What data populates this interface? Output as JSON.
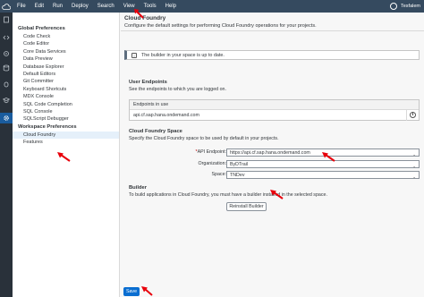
{
  "menubar": {
    "items": [
      "File",
      "Edit",
      "Run",
      "Deploy",
      "Search",
      "View",
      "Tools",
      "Help"
    ],
    "user": "Tesfalem"
  },
  "tree": {
    "global_group": "Global Preferences",
    "global_items": [
      "Code Check",
      "Code Editor",
      "Core Data Services",
      "Data Preview",
      "Database Explorer",
      "Default Editors",
      "Git Committer",
      "Keyboard Shortcuts",
      "MDX Console",
      "SQL Code Completion",
      "SQL Console",
      "SQLScript Debugger"
    ],
    "workspace_group": "Workspace Preferences",
    "workspace_items": [
      "Cloud Foundry",
      "Features"
    ]
  },
  "main": {
    "title": "Cloud Foundry",
    "subtitle": "Configure the default settings for performing Cloud Foundry operations for your projects.",
    "info": "The builder in your space is up to date.",
    "endpoints_title": "User Endpoints",
    "endpoints_desc": "See the endpoints to which you are logged on.",
    "endpoints_col": "Endpoints in use",
    "endpoint_value": "api.cf.sap.hana.ondemand.com",
    "space_title": "Cloud Foundry Space",
    "space_desc": "Specify the Cloud Foundry space to be used by default in your projects.",
    "api_label": "API Endpoint:",
    "api_req": "*",
    "api_value": "https://api.cf.sap.hana.ondemand.com",
    "org_label": "Organization:",
    "org_value": "ByDTrail",
    "space_label": "Space:",
    "space_value": "TNDev",
    "builder_title": "Builder",
    "builder_desc": "To build applications in Cloud Foundry, you must have a builder installed in the selected space.",
    "reinstall_label": "Reinstall Builder",
    "save_label": "Save"
  },
  "colors": {
    "menubar": "#354a5f",
    "rail": "#29313a",
    "accent": "#0a6ed1",
    "annotation": "#e8000b"
  }
}
